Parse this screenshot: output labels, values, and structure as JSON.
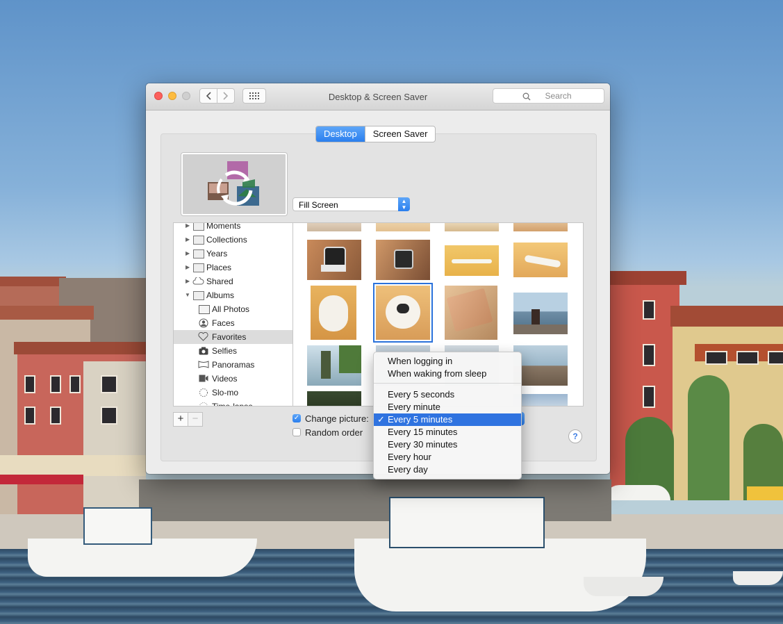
{
  "window": {
    "title": "Desktop & Screen Saver",
    "search_placeholder": "Search",
    "tabs": [
      {
        "label": "Desktop",
        "selected": true
      },
      {
        "label": "Screen Saver",
        "selected": false
      }
    ],
    "fit_popup": "Fill Screen",
    "sidebar": {
      "items": [
        {
          "label": "Moments",
          "icon": "folder-icon"
        },
        {
          "label": "Collections",
          "icon": "folder-icon"
        },
        {
          "label": "Years",
          "icon": "folder-icon"
        },
        {
          "label": "Places",
          "icon": "folder-icon"
        },
        {
          "label": "Shared",
          "icon": "cloud-icon"
        },
        {
          "label": "Albums",
          "icon": "folder-icon"
        },
        {
          "label": "All Photos",
          "icon": "photos-icon"
        },
        {
          "label": "Faces",
          "icon": "face-icon"
        },
        {
          "label": "Favorites",
          "icon": "heart-icon",
          "selected": true
        },
        {
          "label": "Selfies",
          "icon": "camera-icon"
        },
        {
          "label": "Panoramas",
          "icon": "panorama-icon"
        },
        {
          "label": "Videos",
          "icon": "video-icon"
        },
        {
          "label": "Slo-mo",
          "icon": "slomo-icon"
        },
        {
          "label": "Time-lapse",
          "icon": "timelapse-icon"
        }
      ]
    },
    "add_button": "+",
    "remove_button": "−",
    "change_picture_label": "Change picture:",
    "change_picture_checked": true,
    "random_order_label": "Random order",
    "random_order_checked": false,
    "help": "?"
  },
  "menu": {
    "items_top": [
      "When logging in",
      "When waking from sleep"
    ],
    "items_bottom": [
      "Every 5 seconds",
      "Every minute",
      "Every 5 minutes",
      "Every 15 minutes",
      "Every 30 minutes",
      "Every hour",
      "Every day"
    ],
    "selected": "Every 5 minutes",
    "checkmark": "✓"
  },
  "colors": {
    "accent": "#2f73e0",
    "close": "#fc605c",
    "minimize": "#fdbc40",
    "zoom": "#cfcfcf"
  }
}
